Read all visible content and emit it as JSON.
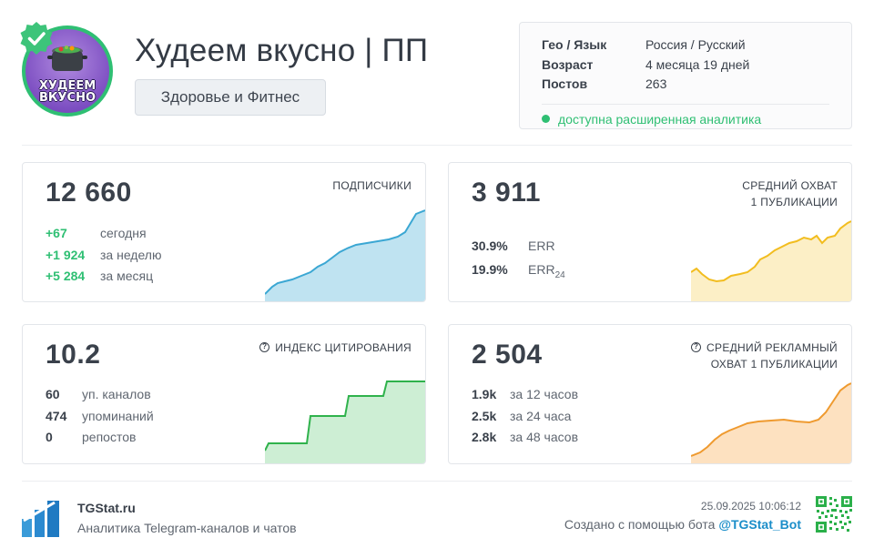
{
  "header": {
    "avatar_text_line1": "ХУДЕЕМ",
    "avatar_text_line2": "ВКУСНО",
    "title": "Худеем вкусно | ПП",
    "category": "Здоровье и Фитнес"
  },
  "info": {
    "geo_label": "Гео / Язык",
    "geo_value": "Россия / Русский",
    "age_label": "Возраст",
    "age_value": "4 месяца 19 дней",
    "posts_label": "Постов",
    "posts_value": "263",
    "analytics_note": "доступна расширенная аналитика"
  },
  "subscribers": {
    "value": "12 660",
    "label": "ПОДПИСЧИКИ",
    "rows": [
      {
        "num": "+67",
        "text": "сегодня"
      },
      {
        "num": "+1 924",
        "text": "за неделю"
      },
      {
        "num": "+5 284",
        "text": "за месяц"
      }
    ],
    "color": "#3ba7d3",
    "fill": "#bfe3f1"
  },
  "reach": {
    "value": "3 911",
    "label_line1": "СРЕДНИЙ ОХВАТ",
    "label_line2": "1 ПУБЛИКАЦИИ",
    "err": {
      "num": "30.9%",
      "text": "ERR"
    },
    "err24": {
      "num": "19.9%",
      "text": "ERR",
      "sub": "24"
    },
    "color": "#f2bd1f",
    "fill": "#fcefc6"
  },
  "citation": {
    "value": "10.2",
    "label": "ИНДЕКС ЦИТИРОВАНИЯ",
    "rows": [
      {
        "num": "60",
        "text": "уп. каналов"
      },
      {
        "num": "474",
        "text": "упоминаний"
      },
      {
        "num": "0",
        "text": "репостов"
      }
    ],
    "color": "#2fb24c",
    "fill": "#cdeed4"
  },
  "ad_reach": {
    "value": "2 504",
    "label_line1": "СРЕДНИЙ РЕКЛАМНЫЙ",
    "label_line2": "ОХВАТ 1 ПУБЛИКАЦИИ",
    "rows": [
      {
        "num": "1.9k",
        "text": "за 12 часов"
      },
      {
        "num": "2.5k",
        "text": "за 24 часа"
      },
      {
        "num": "2.8k",
        "text": "за 48 часов"
      }
    ],
    "color": "#ef9a2f",
    "fill": "#fde1c0"
  },
  "footer": {
    "brand": "TGStat.ru",
    "tagline": "Аналитика Telegram-каналов и чатов",
    "timestamp": "25.09.2025 10:06:12",
    "created_prefix": "Создано с помощью бота ",
    "bot": "@TGStat_Bot"
  }
}
